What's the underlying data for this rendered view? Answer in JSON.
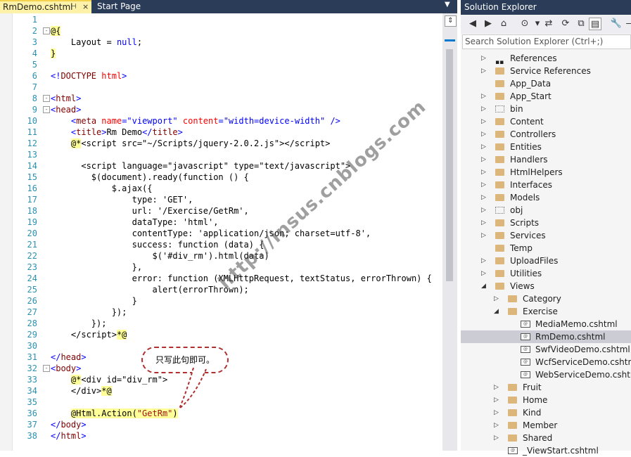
{
  "tabs": {
    "active": "RmDemo.cshtml",
    "active_pin": "⊣",
    "active_close": "×",
    "inactive": "Start Page",
    "dropdown": "▼"
  },
  "editor": {
    "lines": [
      {
        "n": "1",
        "html": ""
      },
      {
        "n": "2",
        "html": "<span class='hl'>@{</span>",
        "fold": "-"
      },
      {
        "n": "3",
        "html": "    <span class='plain'>Layout = </span><span class='kw'>null</span><span class='plain'>;</span>"
      },
      {
        "n": "4",
        "html": "<span class='hl'>}</span>"
      },
      {
        "n": "5",
        "html": ""
      },
      {
        "n": "6",
        "html": "<span class='kw'>&lt;!</span><span class='tag'>DOCTYPE</span> <span class='attr'>html</span><span class='kw'>&gt;</span>"
      },
      {
        "n": "7",
        "html": ""
      },
      {
        "n": "8",
        "html": "<span class='kw'>&lt;</span><span class='tag'>html</span><span class='kw'>&gt;</span>",
        "fold": "-"
      },
      {
        "n": "9",
        "html": "<span class='kw'>&lt;</span><span class='tag'>head</span><span class='kw'>&gt;</span>",
        "fold": "-"
      },
      {
        "n": "10",
        "html": "    <span class='kw'>&lt;</span><span class='tag'>meta</span> <span class='attr'>name</span><span class='kw'>=\"viewport\"</span> <span class='attr'>content</span><span class='kw'>=\"width=device-width\"</span> <span class='kw'>/&gt;</span>"
      },
      {
        "n": "11",
        "html": "    <span class='kw'>&lt;</span><span class='tag'>title</span><span class='kw'>&gt;</span><span class='plain'>Rm Demo</span><span class='kw'>&lt;/</span><span class='tag'>title</span><span class='kw'>&gt;</span>"
      },
      {
        "n": "12",
        "html": "    <span class='hl'>@*</span><span class='plain'>&lt;script src=\"~/Scripts/jquery-2.0.2.js\"&gt;&lt;/script&gt;</span>"
      },
      {
        "n": "13",
        "html": ""
      },
      {
        "n": "14",
        "html": "      <span class='plain'>&lt;script language=\"javascript\" type=\"text/javascript\"&gt;</span>"
      },
      {
        "n": "15",
        "html": "        <span class='plain'>$(document).ready(function () {</span>"
      },
      {
        "n": "16",
        "html": "            <span class='plain'>$.ajax({</span>"
      },
      {
        "n": "17",
        "html": "                <span class='plain'>type: 'GET',</span>"
      },
      {
        "n": "18",
        "html": "                <span class='plain'>url: '/Exercise/GetRm',</span>"
      },
      {
        "n": "19",
        "html": "                <span class='plain'>dataType: 'html',</span>"
      },
      {
        "n": "20",
        "html": "                <span class='plain'>contentType: 'application/json; charset=utf-8',</span>"
      },
      {
        "n": "21",
        "html": "                <span class='plain'>success: function (data) {</span>"
      },
      {
        "n": "22",
        "html": "                    <span class='plain'>$('#div_rm').html(data)</span>"
      },
      {
        "n": "23",
        "html": "                <span class='plain'>},</span>"
      },
      {
        "n": "24",
        "html": "                <span class='plain'>error: function (XMLHttpRequest, textStatus, errorThrown) {</span>"
      },
      {
        "n": "25",
        "html": "                    <span class='plain'>alert(errorThrown);</span>"
      },
      {
        "n": "26",
        "html": "                <span class='plain'>}</span>"
      },
      {
        "n": "27",
        "html": "            <span class='plain'>});</span>"
      },
      {
        "n": "28",
        "html": "        <span class='plain'>});</span>"
      },
      {
        "n": "29",
        "html": "    <span class='plain'>&lt;/script&gt;</span><span class='hl'>*@</span>"
      },
      {
        "n": "30",
        "html": ""
      },
      {
        "n": "31",
        "html": "<span class='kw'>&lt;/</span><span class='tag'>head</span><span class='kw'>&gt;</span>"
      },
      {
        "n": "32",
        "html": "<span class='kw'>&lt;</span><span class='tag'>body</span><span class='kw'>&gt;</span>",
        "fold": "-"
      },
      {
        "n": "33",
        "html": "    <span class='hl'>@*</span><span class='plain'>&lt;div id=\"div_rm\"&gt;</span>"
      },
      {
        "n": "34",
        "html": "    <span class='plain'>&lt;/div&gt;</span><span class='hl'>*@</span>"
      },
      {
        "n": "35",
        "html": ""
      },
      {
        "n": "36",
        "html": "    <span class='hl'>@Html.Action(<span class='jsstr'>\"GetRm\"</span>)</span>"
      },
      {
        "n": "37",
        "html": "<span class='kw'>&lt;/</span><span class='tag'>body</span><span class='kw'>&gt;</span>"
      },
      {
        "n": "38",
        "html": "<span class='kw'>&lt;/</span><span class='tag'>html</span><span class='kw'>&gt;</span>"
      }
    ],
    "split_btn": "⇕"
  },
  "callout": "只写此句即可。",
  "watermark": "http://insus.cnblogs.com",
  "solution_explorer": {
    "title": "Solution Explorer",
    "search_placeholder": "Search Solution Explorer (Ctrl+;)",
    "toolbar": [
      "◀",
      "▶",
      "⌂",
      "⊙",
      "▾",
      "⇄",
      "⟳",
      "⧉",
      "▤",
      "🔧",
      "—"
    ],
    "tree": [
      {
        "label": "References",
        "arrow": "▷",
        "icon": "refs",
        "depth": 0
      },
      {
        "label": "Service References",
        "arrow": "▷",
        "icon": "folder",
        "depth": 0
      },
      {
        "label": "App_Data",
        "arrow": "",
        "icon": "folder",
        "depth": 0
      },
      {
        "label": "App_Start",
        "arrow": "▷",
        "icon": "folder",
        "depth": 0
      },
      {
        "label": "bin",
        "arrow": "▷",
        "icon": "folder-dashed",
        "depth": 0
      },
      {
        "label": "Content",
        "arrow": "▷",
        "icon": "folder",
        "depth": 0
      },
      {
        "label": "Controllers",
        "arrow": "▷",
        "icon": "folder",
        "depth": 0
      },
      {
        "label": "Entities",
        "arrow": "▷",
        "icon": "folder",
        "depth": 0
      },
      {
        "label": "Handlers",
        "arrow": "▷",
        "icon": "folder",
        "depth": 0
      },
      {
        "label": "HtmlHelpers",
        "arrow": "▷",
        "icon": "folder",
        "depth": 0
      },
      {
        "label": "Interfaces",
        "arrow": "▷",
        "icon": "folder",
        "depth": 0
      },
      {
        "label": "Models",
        "arrow": "▷",
        "icon": "folder",
        "depth": 0
      },
      {
        "label": "obj",
        "arrow": "▷",
        "icon": "folder-dashed",
        "depth": 0
      },
      {
        "label": "Scripts",
        "arrow": "▷",
        "icon": "folder",
        "depth": 0
      },
      {
        "label": "Services",
        "arrow": "▷",
        "icon": "folder",
        "depth": 0
      },
      {
        "label": "Temp",
        "arrow": "",
        "icon": "folder",
        "depth": 0
      },
      {
        "label": "UploadFiles",
        "arrow": "▷",
        "icon": "folder",
        "depth": 0
      },
      {
        "label": "Utilities",
        "arrow": "▷",
        "icon": "folder",
        "depth": 0
      },
      {
        "label": "Views",
        "arrow": "◢",
        "icon": "folder",
        "depth": 0
      },
      {
        "label": "Category",
        "arrow": "▷",
        "icon": "folder",
        "depth": 1
      },
      {
        "label": "Exercise",
        "arrow": "◢",
        "icon": "folder",
        "depth": 1
      },
      {
        "label": "MediaMemo.cshtml",
        "arrow": "",
        "icon": "page",
        "depth": 2
      },
      {
        "label": "RmDemo.cshtml",
        "arrow": "",
        "icon": "page",
        "depth": 2,
        "selected": true
      },
      {
        "label": "SwfVideoDemo.cshtml",
        "arrow": "",
        "icon": "page",
        "depth": 2
      },
      {
        "label": "WcfServiceDemo.cshtml",
        "arrow": "",
        "icon": "page",
        "depth": 2
      },
      {
        "label": "WebServiceDemo.cshtml",
        "arrow": "",
        "icon": "page",
        "depth": 2
      },
      {
        "label": "Fruit",
        "arrow": "▷",
        "icon": "folder",
        "depth": 1
      },
      {
        "label": "Home",
        "arrow": "▷",
        "icon": "folder",
        "depth": 1
      },
      {
        "label": "Kind",
        "arrow": "▷",
        "icon": "folder",
        "depth": 1
      },
      {
        "label": "Member",
        "arrow": "▷",
        "icon": "folder",
        "depth": 1
      },
      {
        "label": "Shared",
        "arrow": "▷",
        "icon": "folder",
        "depth": 1
      },
      {
        "label": "_ViewStart.cshtml",
        "arrow": "",
        "icon": "page",
        "depth": 1
      }
    ]
  }
}
